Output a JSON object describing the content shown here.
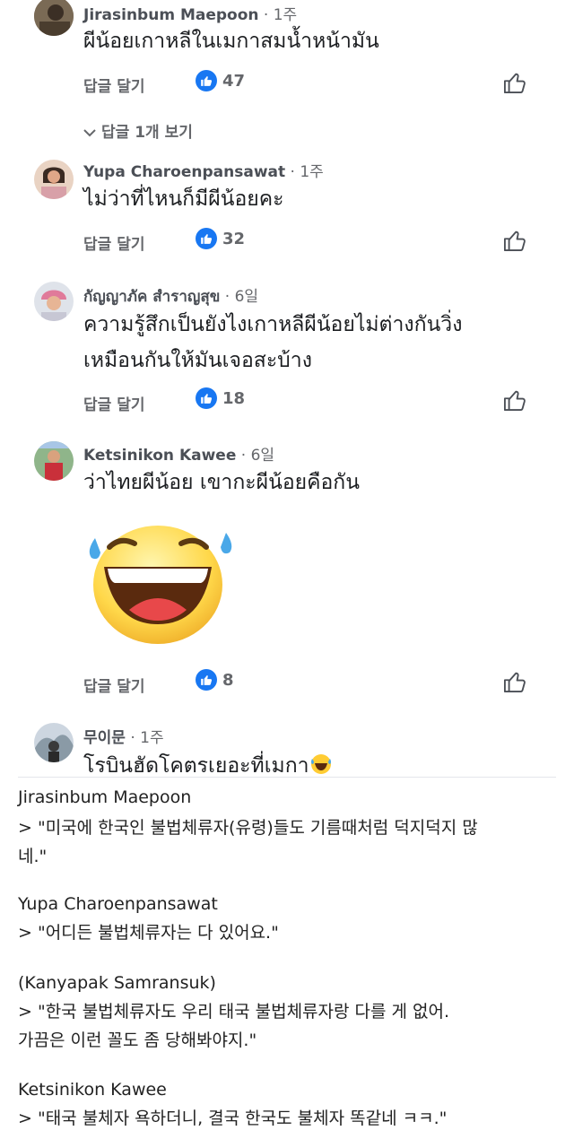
{
  "comments": [
    {
      "name": "Jirasinbum Maepoon",
      "time": " · 1주",
      "text": "ผีน้อยเกาหลีในเมกาสมน้ำหน้ามัน",
      "reply": "답글 달기",
      "likes": "47"
    },
    {
      "name": "Yupa Charoenpansawat",
      "time": " · 1주",
      "text": "ไม่ว่าที่ไหนก็มีผีน้อยคะ",
      "reply": "답글 달기",
      "likes": "32"
    },
    {
      "name": "กัญญาภัค สำราญสุข",
      "time": " · 6일",
      "text1": "ความรู้สึกเป็นยังไงเกาหลีผีน้อยไม่ต่างกันวิ่ง",
      "text2": "เหมือนกันให้มันเจอสะบ้าง",
      "reply": "답글 달기",
      "likes": "18"
    },
    {
      "name": "Ketsinikon Kawee",
      "time": " · 6일",
      "text": "ว่าไทยผีน้อย เขากะผีน้อยคือกัน",
      "reply": "답글 달기",
      "likes": "8"
    },
    {
      "name": "무이문",
      "time": " · 1주",
      "text": "โรบินฮัดโคตรเยอะที่เมกา"
    }
  ],
  "view_replies": "답글 1개 보기",
  "translations": [
    {
      "who": "Jirasinbum Maepoon",
      "line1": "> \"미국에 한국인 불법체류자(유령)들도 기름때처럼 덕지덕지 많",
      "line2": "네.\""
    },
    {
      "who": "Yupa Charoenpansawat",
      "line1": "> \"어디든 불법체류자는 다 있어요.\""
    },
    {
      "who": "(Kanyapak Samransuk)",
      "line1": "> \"한국 불법체류자도 우리 태국 불법체류자랑 다를 게 없어.",
      "line2": "가끔은 이런 꼴도 좀 당해봐야지.\""
    },
    {
      "who": "Ketsinikon Kawee",
      "line1": "> \"태국 불체자 욕하더니, 결국 한국도 불체자 똑같네 ㅋㅋ.\""
    }
  ],
  "icons": {
    "like_badge": "thumbs-up-icon",
    "like_button": "thumbs-up-outline-icon",
    "emoji": "laughing-tears-emoji",
    "accent": "#1877f2"
  }
}
